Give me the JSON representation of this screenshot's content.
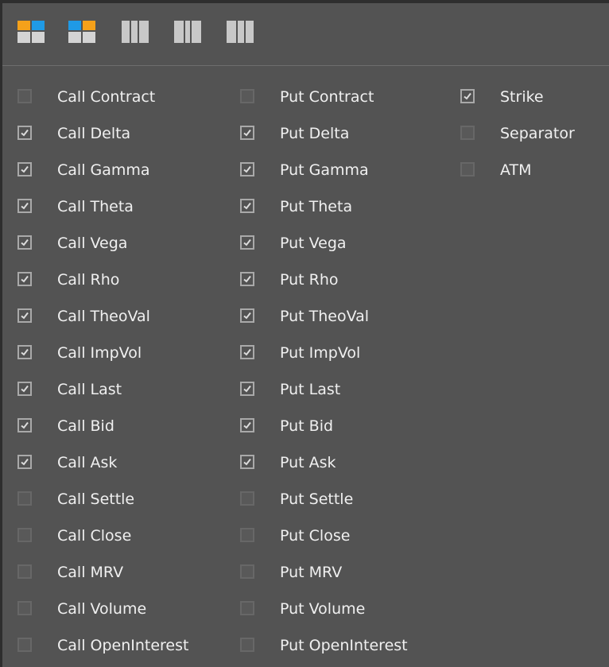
{
  "colors": {
    "panel_bg": "#535353",
    "orange": "#f5a11a",
    "blue": "#1f9ae6",
    "icon_gray": "#c8c8c8",
    "text": "#f0f0f0"
  },
  "toolbar": {
    "buttons": [
      {
        "icon": "layout-orange-left-blue-right-icon"
      },
      {
        "icon": "layout-blue-left-orange-right-icon"
      },
      {
        "icon": "layout-split-left-icon"
      },
      {
        "icon": "layout-split-center-icon"
      },
      {
        "icon": "layout-split-right-icon"
      }
    ]
  },
  "columns": [
    {
      "items": [
        {
          "label": "Call Contract",
          "checked": false
        },
        {
          "label": "Call Delta",
          "checked": true
        },
        {
          "label": "Call Gamma",
          "checked": true
        },
        {
          "label": "Call Theta",
          "checked": true
        },
        {
          "label": "Call Vega",
          "checked": true
        },
        {
          "label": "Call Rho",
          "checked": true
        },
        {
          "label": "Call TheoVal",
          "checked": true
        },
        {
          "label": "Call ImpVol",
          "checked": true
        },
        {
          "label": "Call Last",
          "checked": true
        },
        {
          "label": "Call Bid",
          "checked": true
        },
        {
          "label": "Call Ask",
          "checked": true
        },
        {
          "label": "Call Settle",
          "checked": false
        },
        {
          "label": "Call Close",
          "checked": false
        },
        {
          "label": "Call MRV",
          "checked": false
        },
        {
          "label": "Call Volume",
          "checked": false
        },
        {
          "label": "Call OpenInterest",
          "checked": false
        }
      ]
    },
    {
      "items": [
        {
          "label": "Put Contract",
          "checked": false
        },
        {
          "label": "Put Delta",
          "checked": true
        },
        {
          "label": "Put Gamma",
          "checked": true
        },
        {
          "label": "Put Theta",
          "checked": true
        },
        {
          "label": "Put Vega",
          "checked": true
        },
        {
          "label": "Put Rho",
          "checked": true
        },
        {
          "label": "Put TheoVal",
          "checked": true
        },
        {
          "label": "Put ImpVol",
          "checked": true
        },
        {
          "label": "Put Last",
          "checked": true
        },
        {
          "label": "Put Bid",
          "checked": true
        },
        {
          "label": "Put Ask",
          "checked": true
        },
        {
          "label": "Put Settle",
          "checked": false
        },
        {
          "label": "Put Close",
          "checked": false
        },
        {
          "label": "Put MRV",
          "checked": false
        },
        {
          "label": "Put Volume",
          "checked": false
        },
        {
          "label": "Put OpenInterest",
          "checked": false
        }
      ]
    },
    {
      "items": [
        {
          "label": "Strike",
          "checked": true
        },
        {
          "label": "Separator",
          "checked": false
        },
        {
          "label": "ATM",
          "checked": false
        }
      ]
    }
  ]
}
